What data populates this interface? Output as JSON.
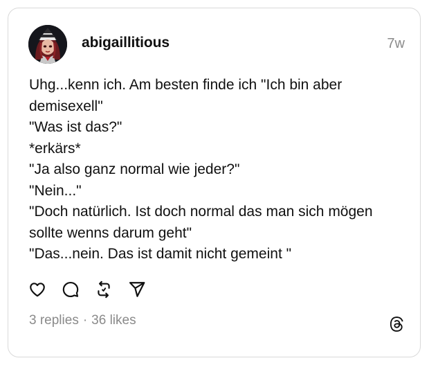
{
  "post": {
    "author": {
      "username": "abigaillitious",
      "avatar_icon": "profile-avatar"
    },
    "timestamp": "7w",
    "lines": [
      "Uhg...kenn ich. Am besten finde ich \"Ich bin aber",
      "demisexell\"",
      "\"Was ist das?\"",
      "*erkärs*",
      "\"Ja also ganz normal wie jeder?\"",
      "\"Nein...\"",
      "\"Doch natürlich. Ist doch normal das man sich mögen",
      "sollte wenns darum geht\"",
      "\"Das...nein. Das ist damit nicht gemeint \""
    ],
    "actions": {
      "like_icon": "heart-icon",
      "reply_icon": "comment-icon",
      "repost_icon": "repost-icon",
      "share_icon": "send-icon"
    },
    "stats": {
      "replies": "3 replies",
      "separator": "·",
      "likes": "36 likes"
    },
    "brand_icon": "threads-logo-icon"
  },
  "colors": {
    "text": "#101010",
    "muted": "#8a8a8a",
    "border": "#d9d9d9",
    "background": "#ffffff"
  }
}
